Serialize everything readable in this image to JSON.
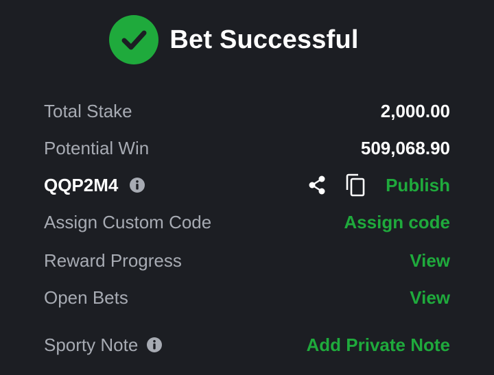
{
  "header": {
    "title": "Bet Successful",
    "icon": "check-circle-icon",
    "accent_color": "#1faa3c"
  },
  "details": {
    "total_stake": {
      "label": "Total Stake",
      "value": "2,000.00"
    },
    "potential_win": {
      "label": "Potential Win",
      "value": "509,068.90"
    },
    "booking": {
      "code": "QQP2M4",
      "info_icon": "info-icon",
      "share_icon": "share-icon",
      "copy_icon": "copy-icon",
      "publish_label": "Publish"
    },
    "custom_code": {
      "label": "Assign Custom Code",
      "action": "Assign code"
    },
    "reward_progress": {
      "label": "Reward Progress",
      "action": "View"
    },
    "open_bets": {
      "label": "Open Bets",
      "action": "View"
    },
    "sporty_note": {
      "label": "Sporty Note",
      "info_icon": "info-icon",
      "action": "Add Private Note"
    }
  }
}
